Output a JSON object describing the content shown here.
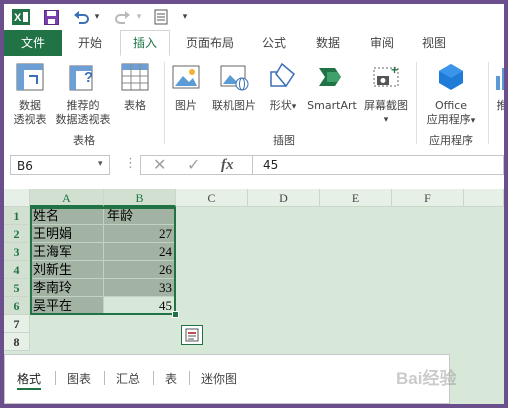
{
  "qat": {
    "app_icon": "excel-icon",
    "save_icon": "save-icon",
    "undo_icon": "undo-icon",
    "redo_icon": "redo-icon",
    "customize_icon": "print-preview-icon"
  },
  "tabs": [
    "文件",
    "开始",
    "插入",
    "页面布局",
    "公式",
    "数据",
    "审阅",
    "视图"
  ],
  "active_tab": "插入",
  "ribbon": {
    "pivot_table": [
      "数据",
      "透视表"
    ],
    "recommended_pivot": [
      "推荐的",
      "数据透视表"
    ],
    "table": "表格",
    "group_tables": "表格",
    "picture": "图片",
    "online_picture": "联机图片",
    "shapes": "形状",
    "smartart": "SmartArt",
    "screenshot": "屏幕截图",
    "group_illustrations": "插图",
    "office_apps": [
      "Office",
      "应用程序"
    ],
    "group_apps": "应用程序",
    "cut_label": "推"
  },
  "formula_bar": {
    "name_box": "B6",
    "fx": "fx",
    "value": "45"
  },
  "columns": [
    "A",
    "B",
    "C",
    "D",
    "E",
    "F"
  ],
  "rows": [
    "1",
    "2",
    "3",
    "4",
    "5",
    "6",
    "7",
    "8"
  ],
  "sheet": {
    "header": [
      "姓名",
      "年龄"
    ],
    "data": [
      [
        "王明娟",
        "27"
      ],
      [
        "王海军",
        "24"
      ],
      [
        "刘新生",
        "26"
      ],
      [
        "李南玲",
        "33"
      ],
      [
        "吴平在",
        "45"
      ]
    ]
  },
  "quick_analysis": {
    "tabs": [
      "格式",
      "图表",
      "汇总",
      "表",
      "迷你图"
    ],
    "active": "格式"
  },
  "watermark": "Bai经验",
  "colors": {
    "accent": "#217346",
    "selection": "#a3b3a3"
  }
}
